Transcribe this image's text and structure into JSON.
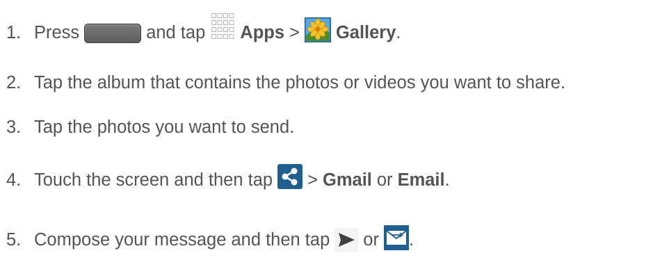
{
  "steps": [
    {
      "number": "1.",
      "pre": "Press",
      "mid": "and tap",
      "apps_label": "Apps",
      "sep": ">",
      "gallery_label": "Gallery",
      "end": ".",
      "icons": [
        "home-key-icon",
        "apps-icon",
        "gallery-icon"
      ]
    },
    {
      "number": "2.",
      "text": "Tap the album that contains the photos or videos you want to share."
    },
    {
      "number": "3.",
      "text": "Tap the photos you want to send."
    },
    {
      "number": "4.",
      "pre": "Touch the screen and then tap",
      "sep": ">",
      "gmail_label": "Gmail",
      "or": "or",
      "email_label": "Email",
      "end": ".",
      "icons": [
        "share-icon"
      ]
    },
    {
      "number": "5.",
      "pre": "Compose your message and then tap",
      "or": "or",
      "end": ".",
      "icons": [
        "send-icon",
        "email-send-icon"
      ]
    }
  ],
  "colors": {
    "text": "#545454",
    "icon_dark_blue": "#1f5f8f",
    "gallery_yellow": "#f2c230",
    "gallery_blue": "#3f8fd0"
  }
}
